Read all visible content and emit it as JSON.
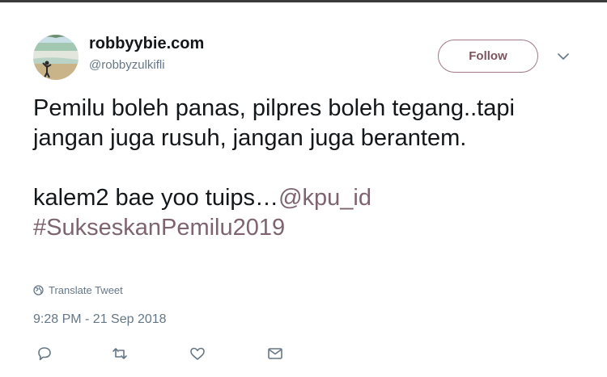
{
  "user": {
    "display_name": "robbyybie.com",
    "handle": "@robbyzulkifli"
  },
  "follow_label": "Follow",
  "tweet": {
    "line1": "Pemilu boleh panas, pilpres boleh tegang..tapi jangan juga rusuh, jangan juga berantem.",
    "line2_text": "kalem2 bae yoo tuips…",
    "mention": "@kpu_id",
    "hashtag": "#SukseskanPemilu2019"
  },
  "translate_label": "Translate Tweet",
  "timestamp": "9:28 PM - 21 Sep 2018",
  "actions": [
    {
      "name": "reply",
      "icon": "reply-icon"
    },
    {
      "name": "retweet",
      "icon": "retweet-icon"
    },
    {
      "name": "like",
      "icon": "heart-icon"
    },
    {
      "name": "direct-message",
      "icon": "envelope-icon"
    }
  ],
  "colors": {
    "text": "#14171a",
    "secondary": "#657786",
    "link": "#7d6470",
    "follow_border": "#9f7a84"
  }
}
